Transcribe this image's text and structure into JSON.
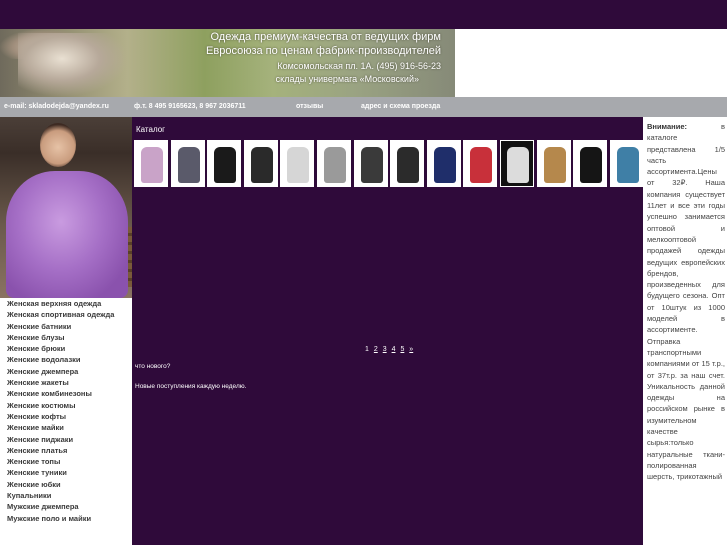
{
  "banner": {
    "line1": "Одежда премиум-качества от ведущих фирм",
    "line2": "Евросоюза по ценам фабрик-производителей",
    "line3": "Комсомольская пл. 1А. (495) 916-56-23",
    "line4": "склады универмага «Московский»"
  },
  "contacts": {
    "email": "e-mail: skladodejda@yandex.ru",
    "phone": "ф.т. 8 495 9165623, 8 967 2036711",
    "reviews": "отзывы",
    "address": "адрес и схема проезда"
  },
  "sidebar": {
    "items": [
      {
        "label": "Женская верхняя одежда"
      },
      {
        "label": "Женская спортивная одежда"
      },
      {
        "label": "Женские батники"
      },
      {
        "label": "Женские блузы"
      },
      {
        "label": "Женские брюки"
      },
      {
        "label": "Женские водолазки"
      },
      {
        "label": "Женские джемпера"
      },
      {
        "label": "Женские жакеты"
      },
      {
        "label": "Женские комбинезоны"
      },
      {
        "label": "Женские костюмы"
      },
      {
        "label": "Женские кофты"
      },
      {
        "label": "Женские майки"
      },
      {
        "label": "Женские пиджаки"
      },
      {
        "label": "Женские платья"
      },
      {
        "label": "Женские топы"
      },
      {
        "label": "Женские туники"
      },
      {
        "label": "Женские юбки"
      },
      {
        "label": "Купальники"
      },
      {
        "label": "Мужские джемпера"
      },
      {
        "label": "Мужские поло и майки"
      }
    ]
  },
  "catalog": {
    "title": "Каталог",
    "thumbnails": [
      {
        "color": "#c9a3c8",
        "bg": "#ffffff"
      },
      {
        "color": "#5a5a6a",
        "bg": "#ffffff"
      },
      {
        "color": "#1a1a1a",
        "bg": "#ffffff"
      },
      {
        "color": "#2a2a2a",
        "bg": "#ffffff"
      },
      {
        "color": "#d6d6d6",
        "bg": "#ffffff"
      },
      {
        "color": "#9a9a9a",
        "bg": "#ffffff"
      },
      {
        "color": "#3a3a3a",
        "bg": "#ffffff"
      },
      {
        "color": "#2b2b2b",
        "bg": "#ffffff"
      },
      {
        "color": "#1f2e6a",
        "bg": "#ffffff"
      },
      {
        "color": "#c8303a",
        "bg": "#ffffff"
      },
      {
        "color": "#dcdcdc",
        "bg": "#111111"
      },
      {
        "color": "#b5884c",
        "bg": "#ffffff"
      },
      {
        "color": "#151515",
        "bg": "#ffffff"
      },
      {
        "color": "#3f7fa6",
        "bg": "#ffffff"
      },
      {
        "color": "#b81e32",
        "bg": "#ffffff"
      }
    ]
  },
  "pager": {
    "current": "1",
    "pages": [
      "2",
      "3",
      "4",
      "5",
      "»"
    ]
  },
  "whats_new": "что нового?",
  "news": "Новые поступления каждую неделю.",
  "notice": {
    "heading": "Внимание:",
    "text": "в каталоге представлена 1/5 часть ассортимента.Цены от 32₽. Наша компания существует 11лет и все эти годы успешно занимается оптовой и мелкооптовой продажей одежды ведущих европейских брендов, произведенных для будущего сезона. Опт от 10штук из 1000 моделей в ассортименте. Отправка транспортными компаниями от 15 т.р., от 37т.р. за наш счет. Уникальность данной одежды на российском рынке в изумительном качестве сырья:только натуральные ткани- полированная шерсть, трикотажный"
  }
}
